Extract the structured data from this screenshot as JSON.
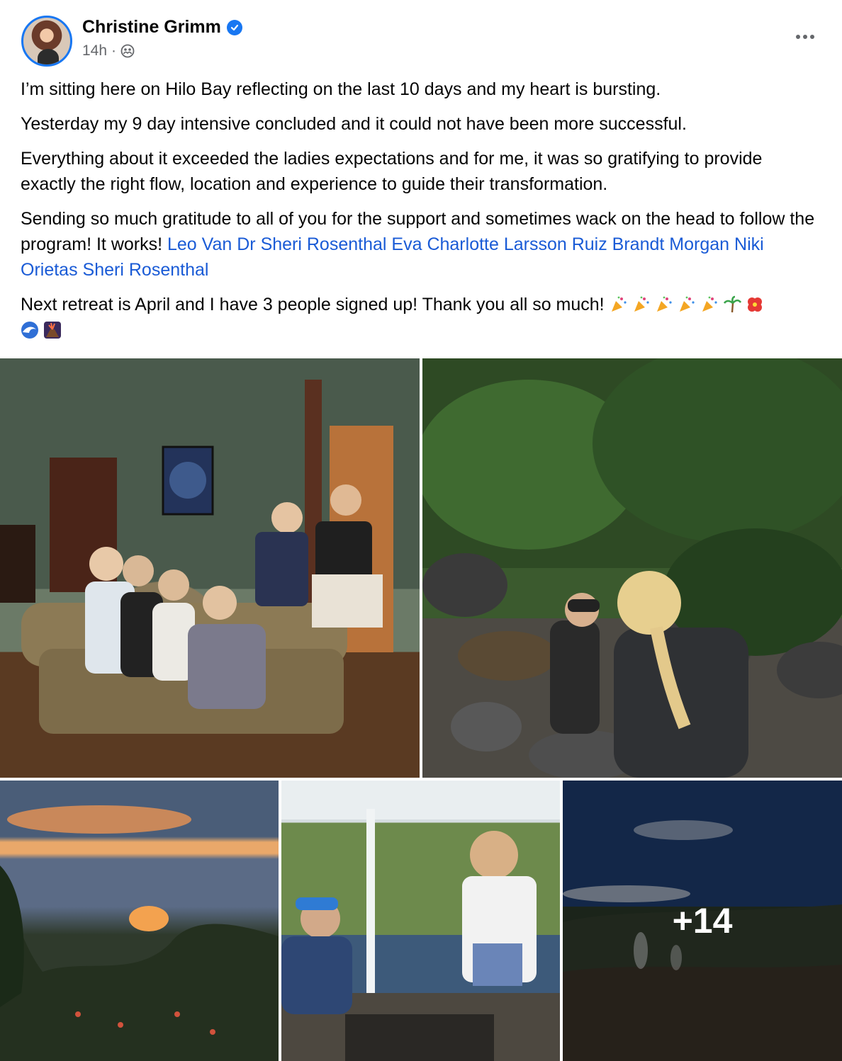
{
  "post": {
    "author": "Christine Grimm",
    "time": "14h",
    "audience_icon": "friends-icon",
    "paragraphs": [
      "I’m sitting here on Hilo Bay reflecting on the last 10 days and my heart is bursting.",
      "Yesterday my 9 day intensive concluded and it could not have been more successful.",
      "Everything about it exceeded the ladies expectations and for me, it was so gratifying to provide exactly the right flow, location and experience to guide their transformation."
    ],
    "para4_text": "Sending so much gratitude to all of you for the support and sometimes wack on the head to follow the program! It works! ",
    "mentions": [
      "Leo Van",
      "Dr Sheri Rosenthal",
      "Eva Charlotte Larsson Ruiz Brandt",
      "Morgan Niki Orietas",
      "Sheri Rosenthal"
    ],
    "para5_text": "Next retreat is April and I have 3 people signed up! Thank you all so much! ",
    "emojis": [
      "party-popper",
      "party-popper",
      "party-popper",
      "party-popper",
      "party-popper",
      "palm-tree",
      "hibiscus",
      "wave",
      "volcano"
    ]
  },
  "photos": {
    "count": 5,
    "more_label": "+14",
    "descriptions": [
      "group-on-couch",
      "creek-hike",
      "sunset-trees",
      "porch-gathering",
      "steam-vents"
    ]
  },
  "colors": {
    "accent": "#1877f2",
    "link": "#1a5bd6",
    "muted": "#65676b"
  }
}
